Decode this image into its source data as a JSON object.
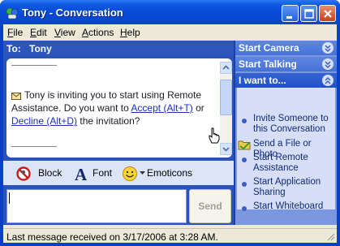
{
  "window": {
    "title": "Tony - Conversation"
  },
  "menu": {
    "file": "File",
    "edit": "Edit",
    "view": "View",
    "actions": "Actions",
    "help": "Help"
  },
  "to_bar": {
    "label": "To:",
    "name": "Tony"
  },
  "message": {
    "text_before": "Tony is inviting you to start using Remote Assistance. Do you want to ",
    "accept_link": "Accept (Alt+T)",
    "text_middle": " or ",
    "decline_link": "Decline (Alt+D)",
    "text_after": " the invitation?"
  },
  "toolbar": {
    "block": "Block",
    "font": "Font",
    "emoticons": "Emoticons"
  },
  "compose": {
    "value": "",
    "send_label": "Send"
  },
  "right_panel": {
    "start_camera": "Start Camera",
    "start_talking": "Start Talking",
    "i_want_to": "I want to...",
    "items": [
      "Invite Someone to this Conversation",
      "Send a File or Photo",
      "Start Remote Assistance",
      "Start Application Sharing",
      "Start Whiteboard"
    ]
  },
  "status": {
    "text": "Last message received on 3/17/2006 at 3:28 AM."
  },
  "icons": {
    "app": "messenger-icon",
    "minimize": "minimize-icon",
    "maximize": "maximize-icon",
    "close": "close-icon",
    "message": "envelope-icon",
    "block": "block-icon",
    "font": "font-icon",
    "emoticons": "smiley-icon",
    "send_file": "folder-icon"
  },
  "colors": {
    "titlebar": "#0a45c8",
    "link": "#1a2fbf",
    "panel_blue": "#2b53b8"
  }
}
